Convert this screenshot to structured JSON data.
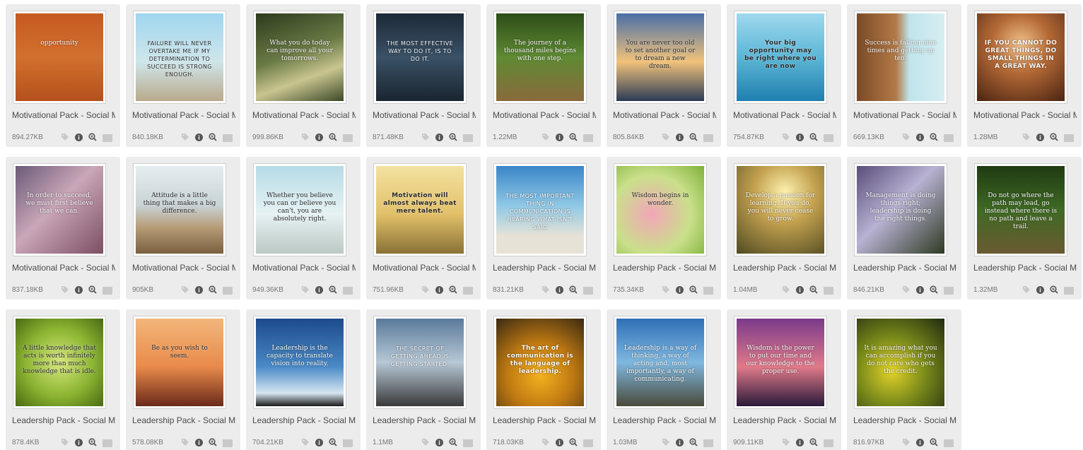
{
  "icons": {
    "tag": "tag-icon",
    "info": "info-icon",
    "zoom": "zoom-in-icon",
    "image": "image-icon"
  },
  "colors": {
    "card_bg": "#ececec",
    "icon_dark": "#555555",
    "icon_light": "#c9c9c9",
    "text": "#4a4a4a"
  },
  "items": [
    {
      "title": "Motivational Pack - Social Media",
      "size": "894.27KB",
      "quote": "opportunity",
      "g": "linear-gradient(180deg,#c65a21,#d2702e 50%,#b5501c)",
      "tc": "light",
      "style": ""
    },
    {
      "title": "Motivational Pack - Social Media",
      "size": "840.18KB",
      "quote": "FAILURE WILL NEVER OVERTAKE ME IF MY DETERMINATION TO SUCCEED IS STRONG ENOUGH.",
      "g": "linear-gradient(180deg,#9fd6ef,#cfe6ea 55%,#b9a98c)",
      "tc": "dark",
      "style": "caps"
    },
    {
      "title": "Motivational Pack - Social Media",
      "size": "999.86KB",
      "quote": "What you do today can improve all your tomorrows.",
      "g": "linear-gradient(160deg,#2e3a1d,#6a7a45 45%,#c9c590 70%,#3d4a28)",
      "tc": "light",
      "style": ""
    },
    {
      "title": "Motivational Pack - Social Media",
      "size": "871.48KB",
      "quote": "THE MOST EFFECTIVE WAY TO DO IT, IS TO DO IT.",
      "g": "linear-gradient(180deg,#1d2a38,#3a5166 50%,#1a2530)",
      "tc": "light",
      "style": "caps"
    },
    {
      "title": "Motivational Pack - Social Media",
      "size": "1.22MB",
      "quote": "The journey of a thousand miles begins with one step.",
      "g": "linear-gradient(180deg,#2d4d18,#5f8a33 50%,#8a6a3c)",
      "tc": "light",
      "style": ""
    },
    {
      "title": "Motivational Pack - Social Media",
      "size": "805.84KB",
      "quote": "You are never too old to set another goal or to dream a new dream.",
      "g": "linear-gradient(180deg,#4a6fa8,#f1c27a 55%,#2b3b55)",
      "tc": "dark",
      "style": ""
    },
    {
      "title": "Motivational Pack - Social Media",
      "size": "754.87KB",
      "quote": "Your big opportunity may be right where you are now",
      "g": "linear-gradient(180deg,#9fd9ee,#5cb6d6 50%,#1f7fae)",
      "tc": "dark",
      "style": "bold"
    },
    {
      "title": "Motivational Pack - Social Media",
      "size": "669.13KB",
      "quote": "Success is falling nine times and getting up ten.",
      "g": "linear-gradient(90deg,#7a4a26,#b37a48 45%,#bfe4ec 60%,#d6eef2)",
      "tc": "light",
      "style": ""
    },
    {
      "title": "Motivational Pack - Social Media",
      "size": "1.28MB",
      "quote": "IF YOU CANNOT DO GREAT THINGS, DO SMALL THINGS IN A GREAT WAY.",
      "g": "radial-gradient(circle at 50% 35%,#f0c28c,#b56a36 40%,#4a2412)",
      "tc": "light",
      "style": "bold"
    },
    {
      "title": "Motivational Pack - Social Media",
      "size": "837.18KB",
      "quote": "In order to succeed, we must first believe that we can.",
      "g": "linear-gradient(135deg,#6a5a78,#c9a6b8 45%,#7d4f63)",
      "tc": "light",
      "style": ""
    },
    {
      "title": "Motivational Pack - Social Media",
      "size": "905KB",
      "quote": "Attitude is a little thing that makes a big difference.",
      "g": "linear-gradient(180deg,#e6edf0,#c8d3d6 45%,#b79c78 70%,#7a6040)",
      "tc": "dark",
      "style": ""
    },
    {
      "title": "Motivational Pack - Social Media",
      "size": "949.36KB",
      "quote": "Whether you believe you can or believe you can't, you are absolutely right.",
      "g": "linear-gradient(180deg,#b7dbe6,#e6f2f3 55%,#bcc8c4)",
      "tc": "dark",
      "style": ""
    },
    {
      "title": "Motivational Pack - Social Media",
      "size": "751.96KB",
      "quote": "Motivation will almost always beat mere talent.",
      "g": "linear-gradient(180deg,#f3e2a0,#e2c06a 55%,#8a7236)",
      "tc": "dark",
      "style": "bold"
    },
    {
      "title": "Leadership Pack - Social Media",
      "size": "831.21KB",
      "quote": "THE MOST IMPORTANT THING IN COMMUNICATION IS HEARING WHAT ISN'T SAID",
      "g": "linear-gradient(180deg,#3a86c8,#8fc8e6 45%,#e6e2d6 80%)",
      "tc": "light",
      "style": "caps"
    },
    {
      "title": "Leadership Pack - Social Media",
      "size": "735.34KB",
      "quote": "Wisdom begins in wonder.",
      "g": "radial-gradient(circle at 40% 55%,#f3a6b8,#c9e08a 55%,#7fb03a)",
      "tc": "dark",
      "style": ""
    },
    {
      "title": "Leadership Pack - Social Media",
      "size": "1.04MB",
      "quote": "Develop a passion for learning. If you do, you will never cease to grow.",
      "g": "radial-gradient(circle at 55% 30%,#fff2b0,#c2a04e 40%,#4f4a22)",
      "tc": "light",
      "style": ""
    },
    {
      "title": "Leadership Pack - Social Media",
      "size": "846.21KB",
      "quote": "Management is doing things right; leadership is doing the right things.",
      "g": "linear-gradient(135deg,#5a4d7a,#b8b2d3 45%,#2e3a22)",
      "tc": "light",
      "style": ""
    },
    {
      "title": "Leadership Pack - Social Media",
      "size": "1.32MB",
      "quote": "Do not go where the path may lead, go instead where there is no path and leave a trail.",
      "g": "linear-gradient(180deg,#1f3a12,#3f6a24 50%,#6a5a32)",
      "tc": "light",
      "style": ""
    },
    {
      "title": "Leadership Pack - Social Media",
      "size": "878.4KB",
      "quote": "A little knowledge that acts is worth infinitely more than much knowledge that is idle.",
      "g": "radial-gradient(circle at 50% 50%,#d6e77a,#8bb431 55%,#4a6a12)",
      "tc": "dark",
      "style": ""
    },
    {
      "title": "Leadership Pack - Social Media",
      "size": "578.08KB",
      "quote": "Be as you wish to seem.",
      "g": "linear-gradient(180deg,#f2b67a,#e98a4a 55%,#6a2a1a)",
      "tc": "dark",
      "style": ""
    },
    {
      "title": "Leadership Pack - Social Media",
      "size": "704.21KB",
      "quote": "Leadership is the capacity to translate vision into reality.",
      "g": "linear-gradient(180deg,#1d4a8a,#4a8ac6 55%,#d6e6f0 85%,#1a1a1a)",
      "tc": "light",
      "style": ""
    },
    {
      "title": "Leadership Pack - Social Media",
      "size": "1.1MB",
      "quote": "THE SECRET OF GETTING AHEAD IS GETTING STARTED.",
      "g": "linear-gradient(180deg,#5a7a9a,#b7c8d6 50%,#3a3a3a)",
      "tc": "light",
      "style": "caps"
    },
    {
      "title": "Leadership Pack - Social Media",
      "size": "718.03KB",
      "quote": "The art of communication is the language of leadership.",
      "g": "radial-gradient(circle at 50% 65%,#f2b21e,#c07a12 45%,#3a2a12)",
      "tc": "light",
      "style": "bold"
    },
    {
      "title": "Leadership Pack - Social Media",
      "size": "1.03MB",
      "quote": "Leadership is a way of thinking, a way of acting and, most importantly, a way of communicating.",
      "g": "linear-gradient(180deg,#2f6fb6,#7fb8e0 50%,#4a4a3a)",
      "tc": "light",
      "style": ""
    },
    {
      "title": "Leadership Pack - Social Media",
      "size": "909.11KB",
      "quote": "Wisdom is the power to put our time and our knowledge to the proper use.",
      "g": "linear-gradient(180deg,#7a3a8a,#e07a8a 55%,#2a1a3a)",
      "tc": "light",
      "style": ""
    },
    {
      "title": "Leadership Pack - Social Media",
      "size": "816.97KB",
      "quote": "It is amazing what you can accomplish if you do not care who gets the credit.",
      "g": "radial-gradient(circle at 40% 60%,#e2d22a,#7a8a1a 45%,#1f2a10)",
      "tc": "light",
      "style": ""
    }
  ]
}
